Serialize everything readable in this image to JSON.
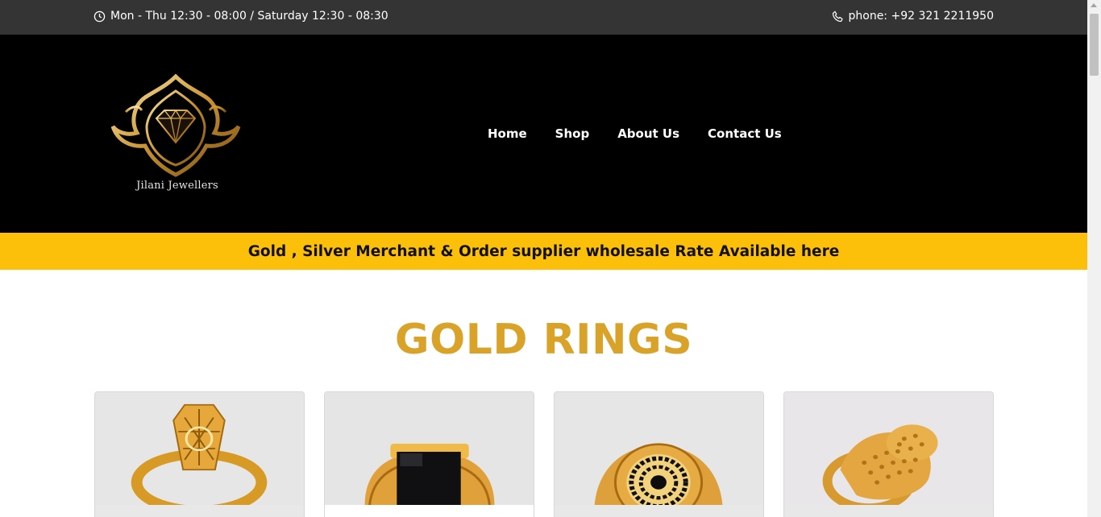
{
  "topbar": {
    "hours": "Mon - Thu 12:30 - 08:00 / Saturday 12:30 - 08:30",
    "phone": "phone: +92 321 2211950",
    "hours_icon": "clock-icon",
    "phone_icon": "phone-icon"
  },
  "header": {
    "brand_name": "Jilani Jewellers",
    "nav": [
      "Home",
      "Shop",
      "About Us",
      "Contact Us"
    ]
  },
  "banner": {
    "text": "Gold , Silver Merchant & Order supplier wholesale Rate Available here"
  },
  "section": {
    "title": "GOLD RINGS"
  },
  "colors": {
    "topbar_bg": "#343434",
    "header_bg": "#000000",
    "banner_bg": "#fcbf0a",
    "title_gold": "#d9a32a"
  },
  "products": [
    {
      "image": "gold-filigree-ring-image"
    },
    {
      "image": "gold-black-stone-ring-image"
    },
    {
      "image": "gold-black-gem-cluster-ring-image"
    },
    {
      "image": "gold-dome-filigree-ring-image"
    }
  ]
}
